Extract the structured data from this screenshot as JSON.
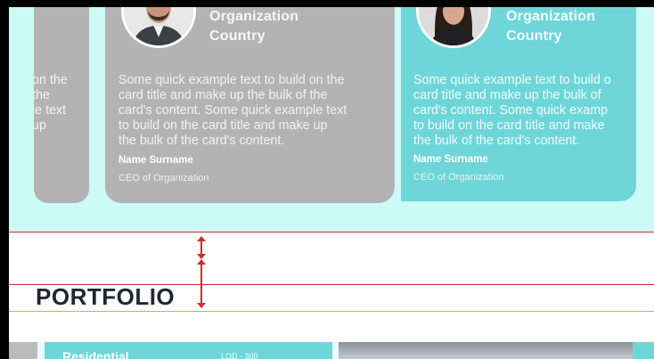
{
  "testimonials": {
    "left_card": {
      "text_lines": [
        "on the",
        "the",
        "le text",
        "up"
      ]
    },
    "center_card": {
      "organization": "Organization",
      "country": "Country",
      "text_lines": [
        "Some quick example text to build on the",
        "card title and make up the bulk of the",
        "card's content. Some quick example text",
        "to build on the card title and make up",
        "the bulk of the card's content."
      ],
      "name": "Name Surname",
      "role": "CEO of Organization",
      "color": "#b3b3b3"
    },
    "right_card": {
      "organization": "Organization",
      "country": "Country",
      "text_lines": [
        "Some quick example text to build o",
        "card title and make up the bulk of",
        "card's content. Some quick examp",
        "to build on the card title and make",
        "the bulk of the card's content."
      ],
      "name": "Name Surname",
      "role": "CEO of Organization",
      "color": "#6ed6d8"
    }
  },
  "section": {
    "title": "PORTFOLIO"
  },
  "portfolio": {
    "first_tile_title": "Residential",
    "first_tile_meta": "LOD - 300"
  },
  "colors": {
    "band_bg": "#ccfaf7",
    "accent_teal": "#6ed6d8",
    "guide_red": "#d22b2b",
    "guide_green": "#7ed36b",
    "title_dark": "#1f2630"
  }
}
